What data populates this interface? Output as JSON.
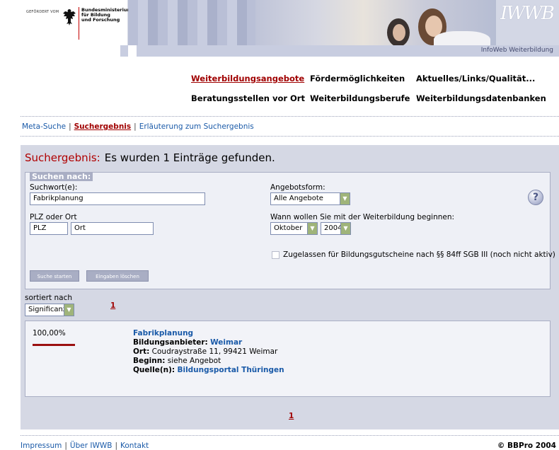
{
  "header": {
    "gefoerdert": "GEFÖRDERT VOM",
    "ministry_line1": "Bundesministerium",
    "ministry_line2": "für Bildung",
    "ministry_line3": "und Forschung",
    "logo": "IWWB",
    "infoweb": "InfoWeb Weiterbildung"
  },
  "nav": {
    "items": [
      {
        "label": "Weiterbildungsangebote"
      },
      {
        "label": "Fördermöglichkeiten"
      },
      {
        "label": "Aktuelles/Links/Qualität..."
      },
      {
        "label": "Beratungsstellen vor Ort"
      },
      {
        "label": "Weiterbildungsberufe"
      },
      {
        "label": "Weiterbildungsdatenbanken"
      }
    ]
  },
  "subnav": {
    "items": [
      {
        "label": "Meta-Suche"
      },
      {
        "label": "Suchergebnis"
      },
      {
        "label": "Erläuterung zum Suchergebnis"
      }
    ],
    "separator": "|"
  },
  "result": {
    "heading_label": "Suchergebnis:",
    "heading_text": "Es wurden 1 Einträge gefunden."
  },
  "search": {
    "legend": "Suchen nach:",
    "keyword_label": "Suchwort(e):",
    "keyword_value": "Fabrikplanung",
    "location_label": "PLZ oder Ort",
    "plz_value": "PLZ",
    "ort_value": "Ort",
    "offer_label": "Angebotsform:",
    "offer_value": "Alle Angebote",
    "start_label": "Wann wollen Sie mit der Weiterbildung beginnen:",
    "month_value": "Oktober",
    "year_value": "2004",
    "voucher_label": "Zugelassen für Bildungsgutscheine nach §§ 84ff SGB III (noch nicht aktiv)",
    "help": "?",
    "start_button": "Suche starten",
    "clear_button": "Eingaben löschen"
  },
  "sort": {
    "label": "sortiert nach",
    "value": "Significanz"
  },
  "pagination": {
    "page": "1"
  },
  "entry": {
    "relevance": "100,00%",
    "relevance_fraction": 1.0,
    "title": "Fabrikplanung",
    "provider_label": "Bildungsanbieter:",
    "provider_value": "Weimar",
    "location_label": "Ort:",
    "location_value": "Coudraystraße 11, 99421 Weimar",
    "start_label": "Beginn:",
    "start_value": "siehe Angebot",
    "source_label": "Quelle(n):",
    "source_value": "Bildungsportal Thüringen"
  },
  "footer": {
    "links": [
      {
        "label": "Impressum"
      },
      {
        "label": "Über IWWB"
      },
      {
        "label": "Kontakt"
      }
    ],
    "separator": "|",
    "copyright": "© BBPro 2004"
  },
  "colors": {
    "accent_red": "#a00000",
    "link_blue": "#1a5aa8",
    "panel_bg": "#d5d8e4"
  }
}
